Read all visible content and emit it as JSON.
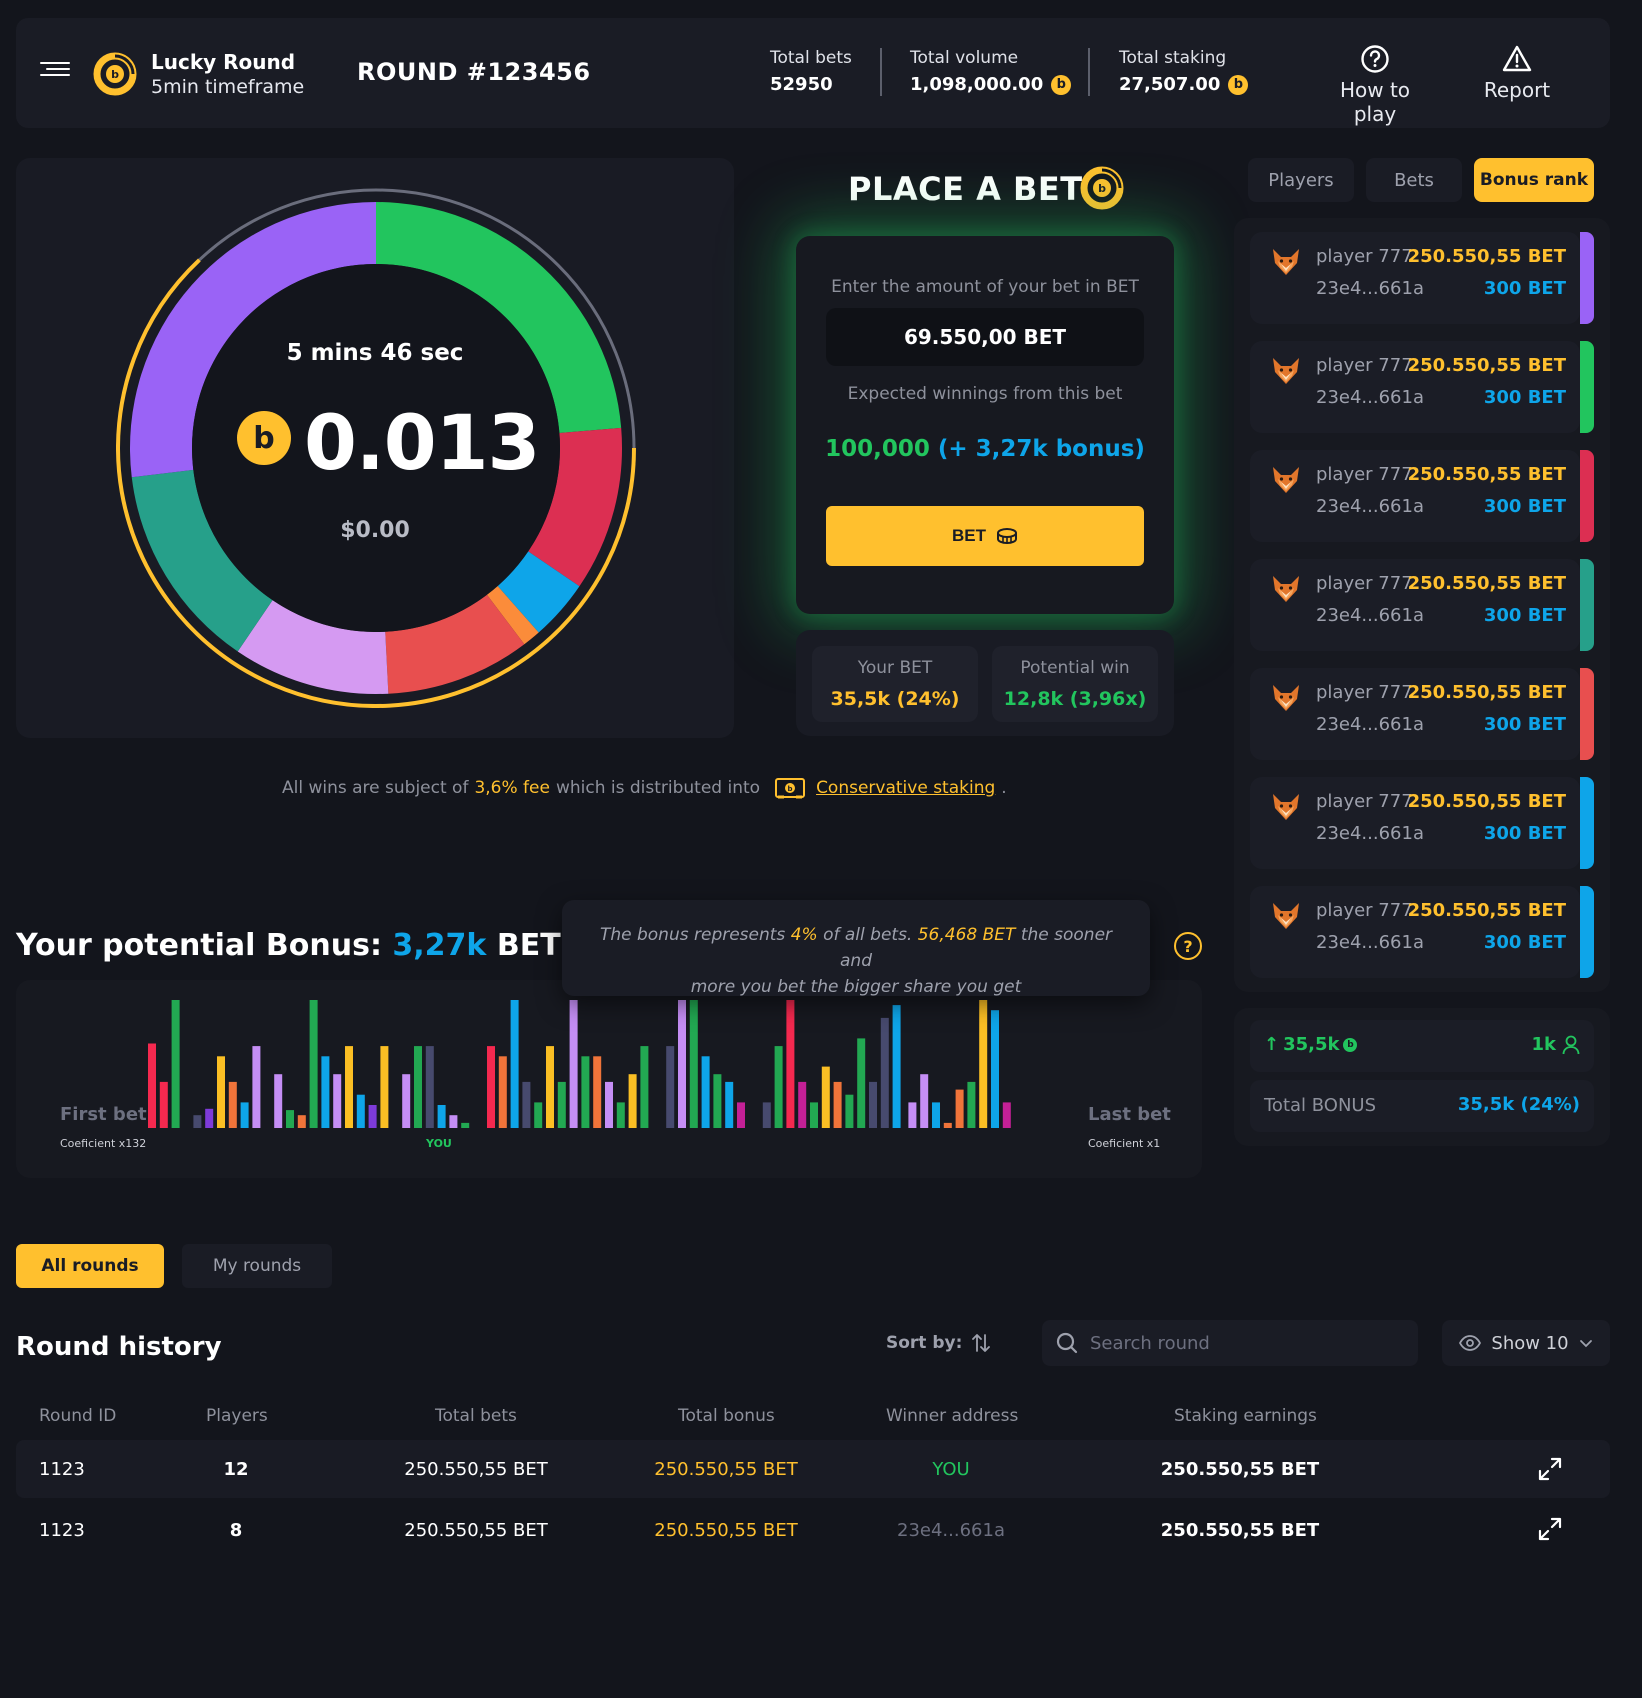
{
  "header": {
    "app_title": "Lucky Round",
    "app_subtitle": "5min timeframe",
    "round": "ROUND #123456",
    "stats": [
      {
        "label": "Total bets",
        "value": "52950"
      },
      {
        "label": "Total volume",
        "value": "1,098,000.00"
      },
      {
        "label": "Total staking",
        "value": "27,507.00"
      }
    ],
    "how_to_play": "How to play",
    "report": "Report"
  },
  "coin_glyph": "b",
  "donut": {
    "timer": "5 mins 46 sec",
    "value": "0.013",
    "usd": "$0.00",
    "segments": [
      {
        "color": "#22c55e",
        "fraction": 0.237
      },
      {
        "color": "#dc2f52",
        "fraction": 0.108
      },
      {
        "color": "#0ea5e9",
        "fraction": 0.04
      },
      {
        "color": "#fb8c3a",
        "fraction": 0.012
      },
      {
        "color": "#e84f4f",
        "fraction": 0.095
      },
      {
        "color": "#d59af2",
        "fraction": 0.103
      },
      {
        "color": "#26a08a",
        "fraction": 0.136
      },
      {
        "color": "#9a63f6",
        "fraction": 0.269
      }
    ],
    "outer_arc_fraction": 0.63,
    "colors": {
      "gold": "#ffc02e",
      "track": "#6a6d7c"
    }
  },
  "place_bet": {
    "title": "PLACE A BET",
    "amount_prompt": "Enter the amount of your bet in BET",
    "amount_value": "69.550,00 BET",
    "expected_label": "Expected winnings from this bet",
    "expected_value": "100,000",
    "expected_bonus": "(+ 3,27k bonus)",
    "bet_button": "BET",
    "your_bet_label": "Your BET",
    "your_bet_value": "35,5k (24%)",
    "potential_win_label": "Potential win",
    "potential_win_value": "12,8k (3,96x)"
  },
  "fee": {
    "prefix": "All wins are subject of",
    "fee": "3,6% fee",
    "middle": "which is distributed into",
    "link": "Conservative staking",
    "suffix": "."
  },
  "right_tabs": {
    "players": "Players",
    "bets": "Bets",
    "bonus_rank": "Bonus rank"
  },
  "players": [
    {
      "name": "player 777",
      "address": "23e4...661a",
      "bet": "250.550,55 BET",
      "bonus": "300 BET",
      "color": "#9a63f6"
    },
    {
      "name": "player 777",
      "address": "23e4...661a",
      "bet": "250.550,55 BET",
      "bonus": "300 BET",
      "color": "#22c55e"
    },
    {
      "name": "player 777",
      "address": "23e4...661a",
      "bet": "250.550,55 BET",
      "bonus": "300 BET",
      "color": "#dc2f52"
    },
    {
      "name": "player 777",
      "address": "23e4...661a",
      "bet": "250.550,55 BET",
      "bonus": "300 BET",
      "color": "#26a08a"
    },
    {
      "name": "player 777",
      "address": "23e4...661a",
      "bet": "250.550,55 BET",
      "bonus": "300 BET",
      "color": "#e84f4f"
    },
    {
      "name": "player 777",
      "address": "23e4...661a",
      "bet": "250.550,55 BET",
      "bonus": "300 BET",
      "color": "#0ea5e9"
    },
    {
      "name": "player 777",
      "address": "23e4...661a",
      "bet": "250.550,55 BET",
      "bonus": "300 BET",
      "color": "#0ea5e9"
    }
  ],
  "summary": {
    "total_value": "35,5k",
    "players_count": "1k",
    "total_bonus_label": "Total BONUS",
    "total_bonus_value": "35,5k (24%)"
  },
  "bonus": {
    "title_prefix": "Your potential Bonus:",
    "title_value": "3,27k",
    "title_suffix": "BET",
    "tooltip_1": "The bonus represents",
    "tooltip_pct": "4%",
    "tooltip_2": "of all bets.",
    "tooltip_amount": "56,468 BET",
    "tooltip_3": "the sooner and",
    "tooltip_4": "more you bet the bigger share you get",
    "help": "?",
    "first_bet": "First bet",
    "first_coef": "Coeficient x132",
    "last_bet": "Last bet",
    "last_coef": "Coeficient x1",
    "you": "YOU"
  },
  "bar_colors": {
    "R": "#f5294f",
    "G": "#22a852",
    "B": "#0ea5e9",
    "Y": "#fbbf24",
    "O": "#f0743a",
    "L": "#c58ef5",
    "P": "#7e3bd9",
    "N": "#474a6e",
    "M": "#c42096"
  },
  "bars": [
    {
      "c": "R",
      "v": 66
    },
    {
      "c": "R",
      "v": 36
    },
    {
      "c": "G",
      "v": 100
    },
    {
      "c": "N",
      "v": 10
    },
    {
      "c": "P",
      "v": 15
    },
    {
      "c": "Y",
      "v": 56
    },
    {
      "c": "O",
      "v": 36
    },
    {
      "c": "B",
      "v": 20
    },
    {
      "c": "L",
      "v": 64
    },
    {
      "c": "L",
      "v": 42
    },
    {
      "c": "G",
      "v": 14
    },
    {
      "c": "O",
      "v": 10
    },
    {
      "c": "G",
      "v": 100
    },
    {
      "c": "B",
      "v": 56
    },
    {
      "c": "L",
      "v": 42
    },
    {
      "c": "Y",
      "v": 64
    },
    {
      "c": "B",
      "v": 26
    },
    {
      "c": "P",
      "v": 18
    },
    {
      "c": "Y",
      "v": 64
    },
    {
      "c": "L",
      "v": 42
    },
    {
      "c": "G",
      "v": 64
    },
    {
      "c": "N",
      "v": 64
    },
    {
      "c": "B",
      "v": 18
    },
    {
      "c": "L",
      "v": 10
    },
    {
      "c": "G",
      "v": 4
    },
    {
      "c": "R",
      "v": 64
    },
    {
      "c": "O",
      "v": 56
    },
    {
      "c": "B",
      "v": 100
    },
    {
      "c": "N",
      "v": 36
    },
    {
      "c": "G",
      "v": 20
    },
    {
      "c": "Y",
      "v": 64
    },
    {
      "c": "G",
      "v": 36
    },
    {
      "c": "L",
      "v": 100
    },
    {
      "c": "G",
      "v": 56
    },
    {
      "c": "O",
      "v": 56
    },
    {
      "c": "L",
      "v": 36
    },
    {
      "c": "G",
      "v": 20
    },
    {
      "c": "Y",
      "v": 42
    },
    {
      "c": "G",
      "v": 64
    },
    {
      "c": "N",
      "v": 64
    },
    {
      "c": "L",
      "v": 100
    },
    {
      "c": "G",
      "v": 100
    },
    {
      "c": "B",
      "v": 56
    },
    {
      "c": "G",
      "v": 42
    },
    {
      "c": "B",
      "v": 36
    },
    {
      "c": "M",
      "v": 20
    },
    {
      "c": "N",
      "v": 20
    },
    {
      "c": "G",
      "v": 64
    },
    {
      "c": "R",
      "v": 100
    },
    {
      "c": "M",
      "v": 36
    },
    {
      "c": "G",
      "v": 20
    },
    {
      "c": "Y",
      "v": 48
    },
    {
      "c": "O",
      "v": 36
    },
    {
      "c": "G",
      "v": 26
    },
    {
      "c": "G",
      "v": 70
    },
    {
      "c": "N",
      "v": 36
    },
    {
      "c": "N",
      "v": 86
    },
    {
      "c": "B",
      "v": 96
    },
    {
      "c": "L",
      "v": 20
    },
    {
      "c": "L",
      "v": 42
    },
    {
      "c": "B",
      "v": 20
    },
    {
      "c": "O",
      "v": 4
    },
    {
      "c": "O",
      "v": 30
    },
    {
      "c": "G",
      "v": 36
    },
    {
      "c": "Y",
      "v": 100
    },
    {
      "c": "B",
      "v": 92
    },
    {
      "c": "M",
      "v": 20
    }
  ],
  "rounds": {
    "tab_all": "All rounds",
    "tab_my": "My rounds",
    "title": "Round history",
    "sort_label": "Sort by:",
    "search_placeholder": "Search round",
    "show": "Show 10",
    "columns": [
      "Round ID",
      "Players",
      "Total bets",
      "Total bonus",
      "Winner address",
      "Staking earnings"
    ],
    "rows": [
      {
        "id": "1123",
        "players": "12",
        "total_bets": "250.550,55 BET",
        "total_bonus": "250.550,55 BET",
        "winner": "YOU",
        "staking": "250.550,55 BET"
      },
      {
        "id": "1123",
        "players": "8",
        "total_bets": "250.550,55 BET",
        "total_bonus": "250.550,55 BET",
        "winner": "23e4...661a",
        "staking": "250.550,55 BET"
      }
    ]
  }
}
